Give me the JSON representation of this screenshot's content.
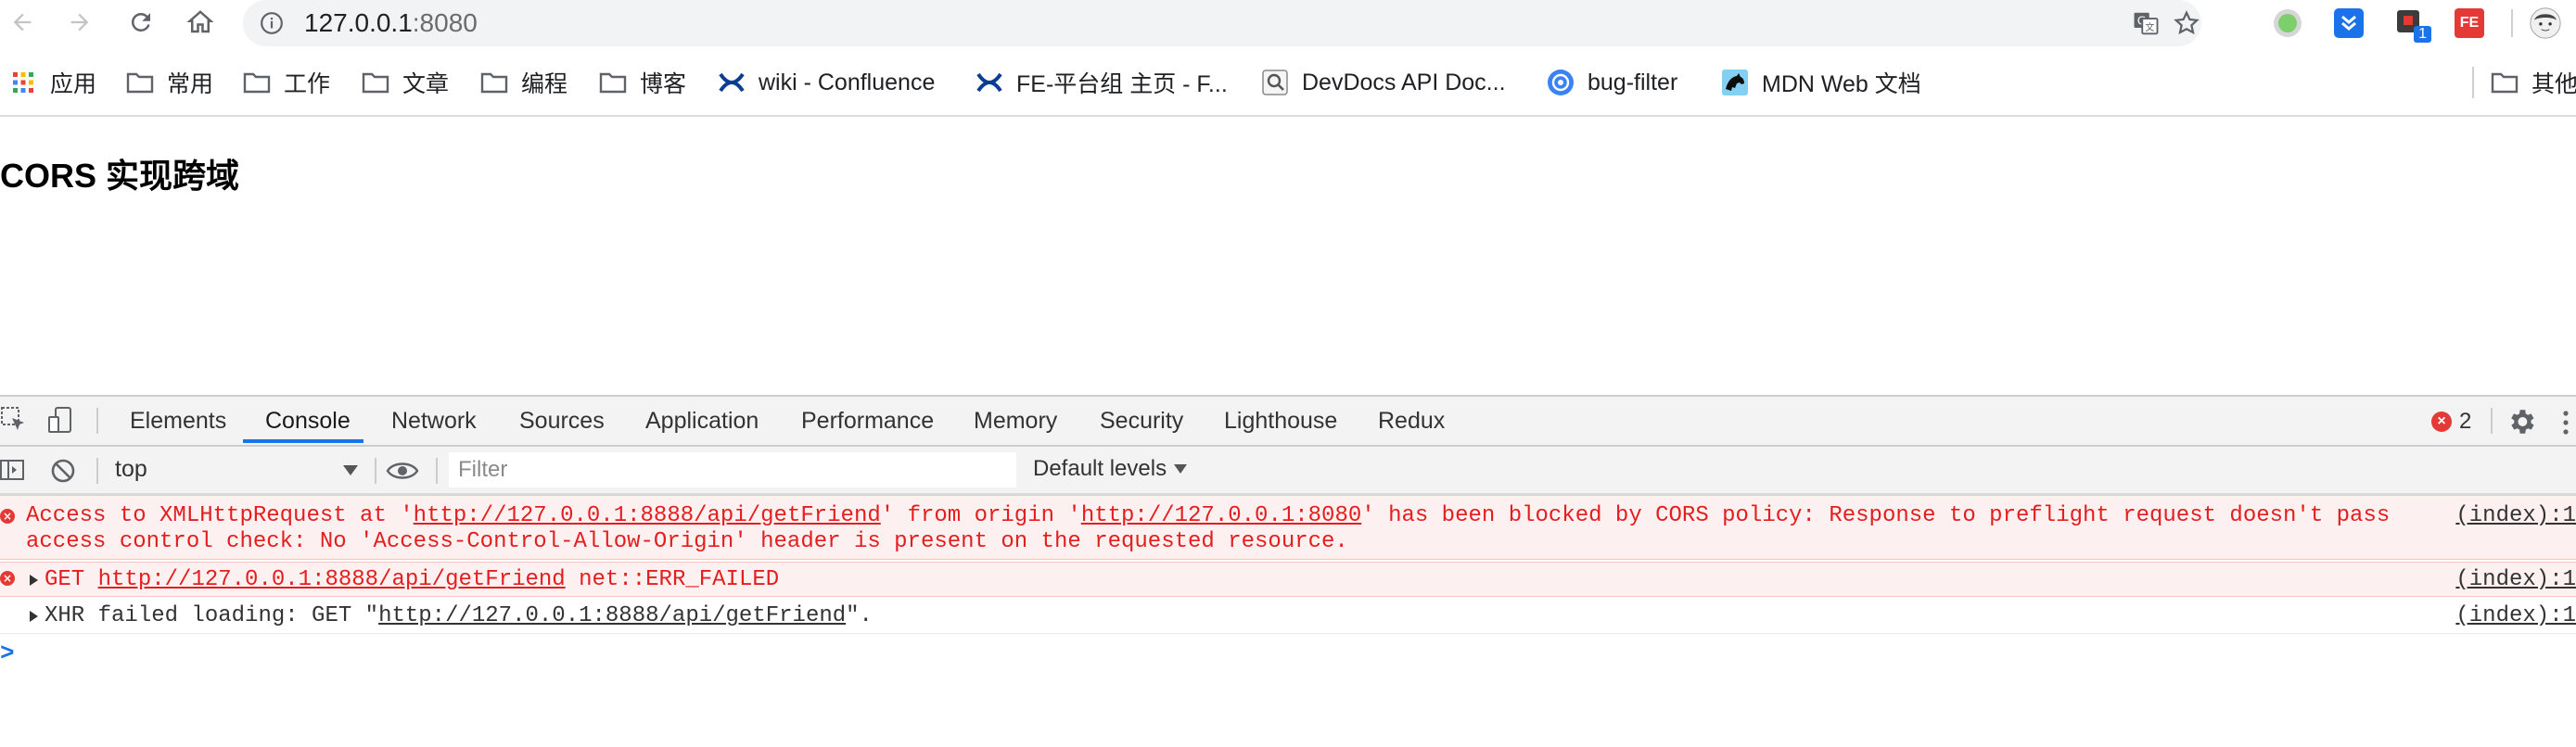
{
  "browser": {
    "url_host": "127.0.0.1",
    "url_port": ":8080",
    "extension_badge": "1",
    "extension_fe_label": "FE"
  },
  "bookmarks": [
    {
      "label": "应用",
      "icon": "apps-grid-icon"
    },
    {
      "label": "常用",
      "icon": "folder-icon"
    },
    {
      "label": "工作",
      "icon": "folder-icon"
    },
    {
      "label": "文章",
      "icon": "folder-icon"
    },
    {
      "label": "编程",
      "icon": "folder-icon"
    },
    {
      "label": "博客",
      "icon": "folder-icon"
    },
    {
      "label": "wiki - Confluence",
      "icon": "confluence-icon"
    },
    {
      "label": "FE-平台组 主页 - F...",
      "icon": "confluence-icon"
    },
    {
      "label": "DevDocs API Doc...",
      "icon": "devdocs-icon"
    },
    {
      "label": "bug-filter",
      "icon": "bug-filter-icon"
    },
    {
      "label": "MDN Web 文档",
      "icon": "mdn-icon"
    },
    {
      "label": "其他",
      "icon": "folder-icon"
    }
  ],
  "page": {
    "title": "CORS 实现跨域"
  },
  "devtools": {
    "tabs": [
      "Elements",
      "Console",
      "Network",
      "Sources",
      "Application",
      "Performance",
      "Memory",
      "Security",
      "Lighthouse",
      "Redux"
    ],
    "active_tab": "Console",
    "error_count": "2",
    "context": "top",
    "filter_placeholder": "Filter",
    "levels": "Default levels",
    "messages": [
      {
        "type": "error",
        "line1_a": "Access to XMLHttpRequest at '",
        "line1_url1": "http://127.0.0.1:8888/api/getFriend",
        "line1_b": "' from origin '",
        "line1_url2": "http://127.0.0.1:8080",
        "line1_c": "' has been blocked by CORS policy: Response to preflight request doesn't pass",
        "line2": "access control check: No 'Access-Control-Allow-Origin' header is present on the requested resource.",
        "source": "(index):1"
      },
      {
        "type": "error",
        "method": "GET",
        "url": "http://127.0.0.1:8888/api/getFriend",
        "status": "net::ERR_FAILED",
        "source": "(index):1"
      },
      {
        "type": "log",
        "prefix": "XHR failed loading: GET \"",
        "url": "http://127.0.0.1:8888/api/getFriend",
        "suffix": "\".",
        "source": "(index):1"
      }
    ],
    "prompt": ">"
  },
  "colors": {
    "error_text": "#e41e1e",
    "error_bg": "#fdf0f0",
    "accent": "#1a73e8"
  }
}
